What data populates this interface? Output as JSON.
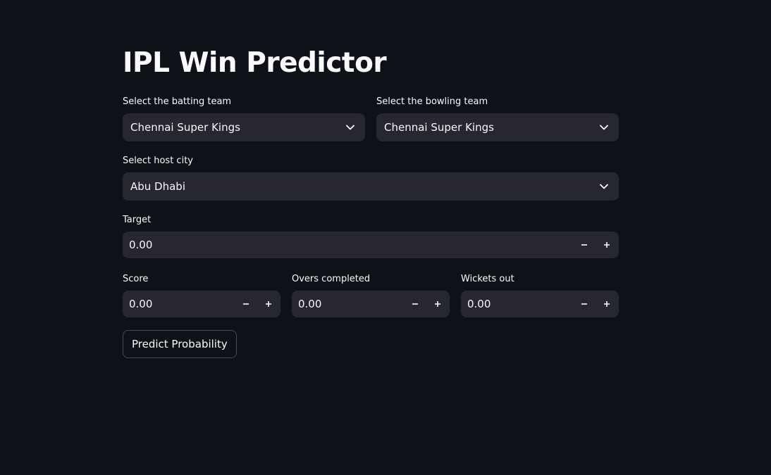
{
  "app": {
    "title": "IPL Win Predictor"
  },
  "batting_team": {
    "label": "Select the batting team",
    "value": "Chennai Super Kings",
    "icon": "chevron-down-icon"
  },
  "bowling_team": {
    "label": "Select the bowling team",
    "value": "Chennai Super Kings",
    "icon": "chevron-down-icon"
  },
  "host_city": {
    "label": "Select host city",
    "value": "Abu Dhabi",
    "icon": "chevron-down-icon"
  },
  "target": {
    "label": "Target",
    "value": "0.00"
  },
  "score": {
    "label": "Score",
    "value": "0.00"
  },
  "overs": {
    "label": "Overs completed",
    "value": "0.00"
  },
  "wickets": {
    "label": "Wickets out",
    "value": "0.00"
  },
  "predict_button": {
    "label": "Predict Probability"
  },
  "colors": {
    "background": "#0e1117",
    "widget": "#262730",
    "text": "#fafafa"
  }
}
